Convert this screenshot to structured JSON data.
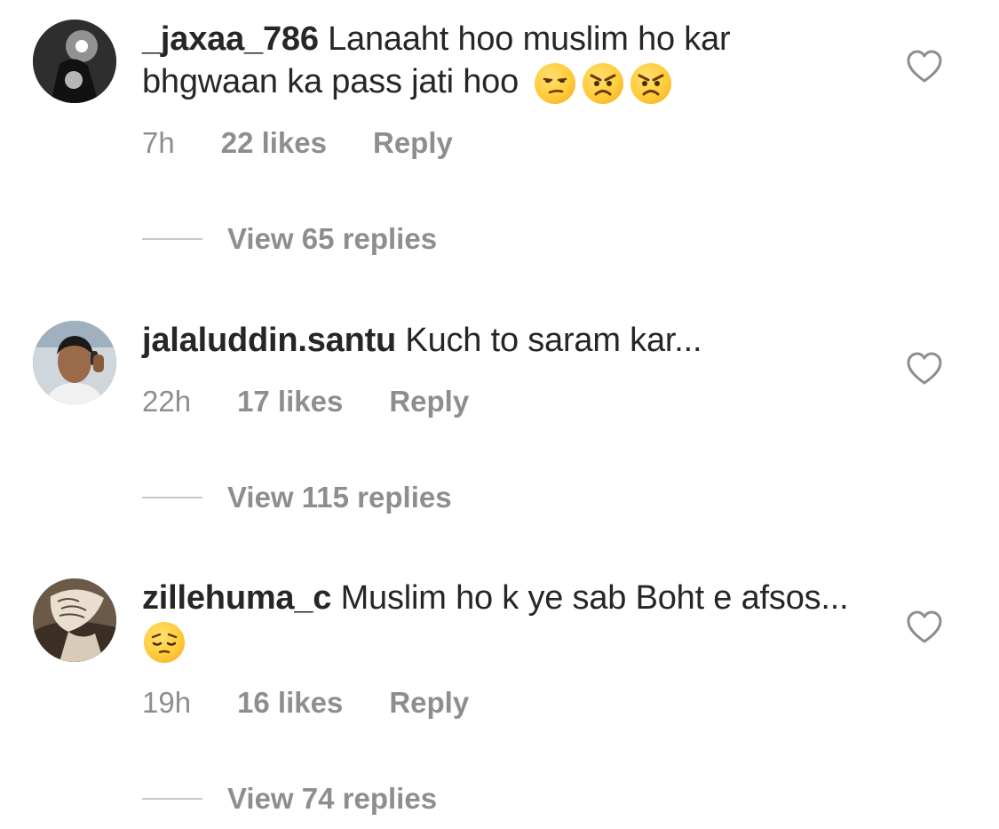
{
  "comments": [
    {
      "username": "_jaxaa_786",
      "text": "Lanaaht hoo muslim ho kar bhgwaan ka pass jati hoo",
      "emojis": [
        "unamused-face",
        "angry-face",
        "angry-face"
      ],
      "time": "7h",
      "likes": "22 likes",
      "reply": "Reply",
      "view_replies": "View 65 replies"
    },
    {
      "username": "jalaluddin.santu",
      "text": "Kuch to saram kar...",
      "emojis": [],
      "time": "22h",
      "likes": "17 likes",
      "reply": "Reply",
      "view_replies": "View 115 replies"
    },
    {
      "username": "zillehuma_c",
      "text": "Muslim ho k ye sab Boht e afsos...",
      "emojis": [
        "pensive-face"
      ],
      "time": "19h",
      "likes": "16 likes",
      "reply": "Reply",
      "view_replies": "View 74 replies"
    }
  ],
  "colors": {
    "text": "#262626",
    "secondary": "#8e8e8e",
    "divider": "#c7c7c7",
    "emoji": "#ffcb3a"
  }
}
